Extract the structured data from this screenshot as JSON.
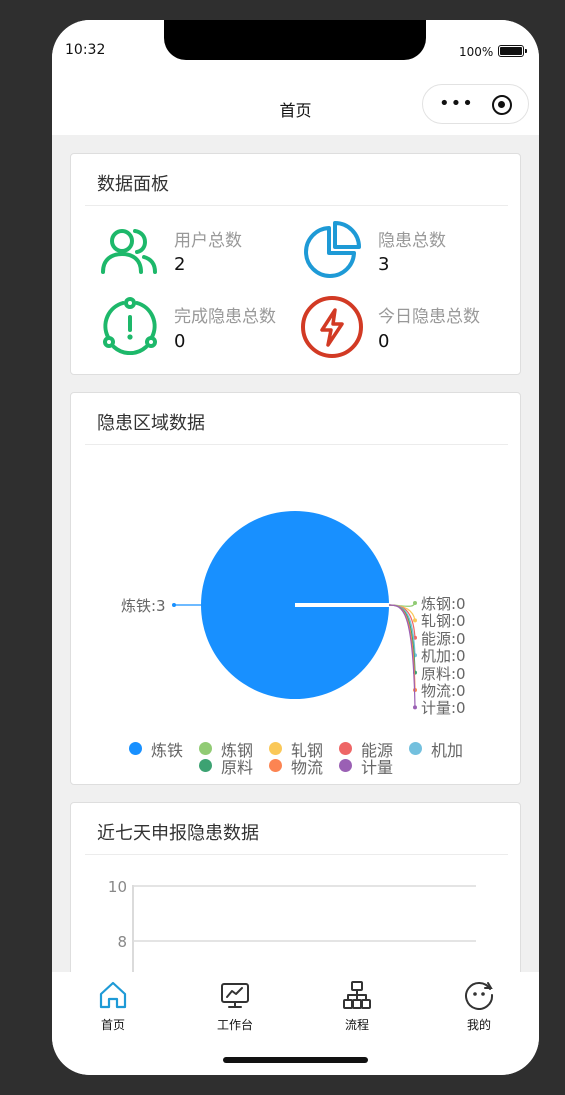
{
  "status": {
    "time": "10:32",
    "battery": "100%"
  },
  "nav": {
    "title": "首页"
  },
  "dashboard": {
    "title": "数据面板",
    "stats": [
      {
        "label": "用户总数",
        "value": "2",
        "icon": "users-icon",
        "color": "#1db86a"
      },
      {
        "label": "隐患总数",
        "value": "3",
        "icon": "pie-chart-icon",
        "color": "#1e9ad6"
      },
      {
        "label": "完成隐患总数",
        "value": "0",
        "icon": "alert-circle-icon",
        "color": "#1db86a"
      },
      {
        "label": "今日隐患总数",
        "value": "0",
        "icon": "lightning-icon",
        "color": "#d23a24"
      }
    ]
  },
  "area_chart": {
    "title": "隐患区域数据",
    "chart_data": {
      "type": "pie",
      "categories": [
        "炼铁",
        "炼钢",
        "轧钢",
        "能源",
        "机加",
        "原料",
        "物流",
        "计量"
      ],
      "values": [
        3,
        0,
        0,
        0,
        0,
        0,
        0,
        0
      ],
      "slice_labels": [
        "炼铁:3",
        "炼钢:0",
        "轧钢:0",
        "能源:0",
        "机加:0",
        "原料:0",
        "物流:0",
        "计量:0"
      ],
      "colors": [
        "#1890ff",
        "#91cb74",
        "#fac858",
        "#ee6666",
        "#73c0de",
        "#3ca272",
        "#fc8452",
        "#9a60b4"
      ],
      "legend": "bottom"
    }
  },
  "weekly_chart": {
    "title": "近七天申报隐患数据",
    "chart_data": {
      "type": "line",
      "y_ticks": [
        "10",
        "8"
      ],
      "grid": true
    }
  },
  "tabbar": {
    "items": [
      {
        "label": "首页",
        "icon": "home-icon"
      },
      {
        "label": "工作台",
        "icon": "monitor-chart-icon"
      },
      {
        "label": "流程",
        "icon": "flowchart-icon"
      },
      {
        "label": "我的",
        "icon": "face-icon"
      }
    ]
  }
}
